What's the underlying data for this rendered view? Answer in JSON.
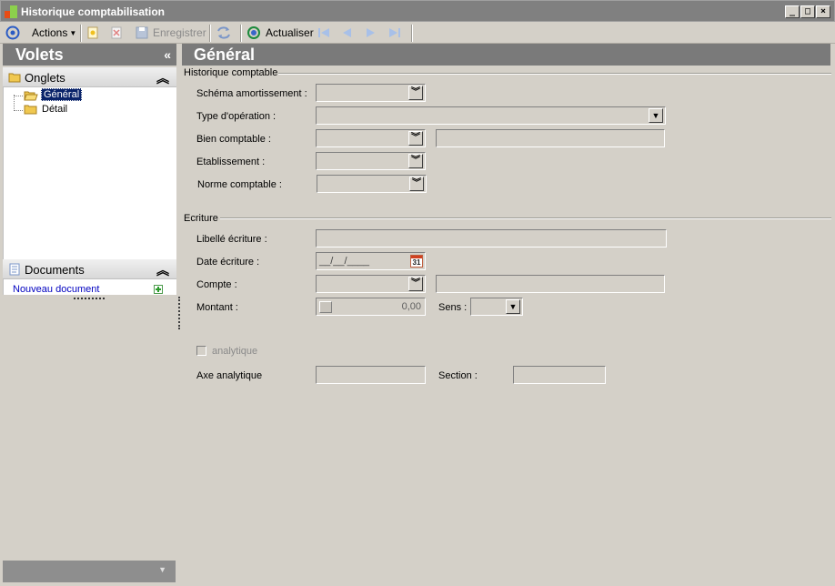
{
  "window": {
    "title": "Historique comptabilisation"
  },
  "toolbar": {
    "actions_label": "Actions",
    "save_label": "Enregistrer",
    "refresh_label": "Actualiser"
  },
  "left_panel": {
    "title": "Volets",
    "collapse_glyph": "«",
    "tabs_section": {
      "title": "Onglets",
      "items": [
        {
          "label": "Général",
          "selected": true
        },
        {
          "label": "Détail",
          "selected": false
        }
      ]
    },
    "documents_section": {
      "title": "Documents",
      "new_doc_label": "Nouveau document"
    }
  },
  "main": {
    "title": "Général",
    "historique_group": {
      "title": "Historique comptable",
      "schema_label": "Schéma amortissement :",
      "type_operation_label": "Type d'opération :",
      "bien_label": "Bien comptable :",
      "etablissement_label": "Etablissement :",
      "norme_label": "Norme comptable :"
    },
    "ecriture_group": {
      "title": "Ecriture",
      "libelle_label": "Libellé écriture :",
      "date_label": "Date écriture :",
      "date_placeholder": "__/__/____",
      "calendar_day": "31",
      "compte_label": "Compte :",
      "montant_label": "Montant :",
      "montant_value": "0,00",
      "sens_label": "Sens :",
      "analytique_label": "analytique",
      "axe_label": "Axe analytique",
      "section_label": "Section :"
    }
  },
  "colors": {
    "header_bg": "#7a7a7a",
    "window_bg": "#d4d0c8",
    "link": "#0000c0"
  }
}
